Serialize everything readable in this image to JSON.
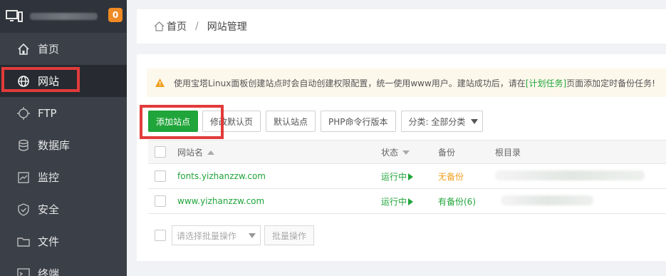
{
  "sidebar": {
    "badge": "0",
    "items": [
      {
        "label": "首页",
        "icon": "home-icon"
      },
      {
        "label": "网站",
        "icon": "globe-icon"
      },
      {
        "label": "FTP",
        "icon": "ftp-icon"
      },
      {
        "label": "数据库",
        "icon": "database-icon"
      },
      {
        "label": "监控",
        "icon": "monitor-chart-icon"
      },
      {
        "label": "安全",
        "icon": "shield-icon"
      },
      {
        "label": "文件",
        "icon": "folder-icon"
      },
      {
        "label": "终端",
        "icon": "terminal-icon"
      }
    ],
    "active_index": 1
  },
  "breadcrumb": {
    "home": "首页",
    "separator": "/",
    "current": "网站管理"
  },
  "notice": {
    "text_before": "使用宝塔Linux面板创建站点时会自动创建权限配置，统一使用www用户。建站成功后，请在",
    "link": "[计划任务]",
    "text_after": "页面添加定时备份任务!"
  },
  "toolbar": {
    "add_site": "添加站点",
    "edit_default_page": "修改默认页",
    "default_site": "默认站点",
    "php_cli_version": "PHP命令行版本",
    "category_label": "分类: 全部分类"
  },
  "table": {
    "columns": {
      "name": "网站名",
      "status": "状态",
      "backup": "备份",
      "root": "根目录"
    },
    "rows": [
      {
        "name": "fonts.yizhanzzw.com",
        "status": "运行中",
        "backup": "无备份"
      },
      {
        "name": "www.yizhanzzw.com",
        "status": "运行中",
        "backup": "有备份(6)"
      }
    ]
  },
  "batch": {
    "select_placeholder": "请选择批量操作",
    "button": "批量操作"
  },
  "colors": {
    "accent_green": "#20a53a",
    "highlight_red": "#e23b3b",
    "badge_orange": "#f08a24",
    "sidebar_bg": "#3a3f48"
  }
}
